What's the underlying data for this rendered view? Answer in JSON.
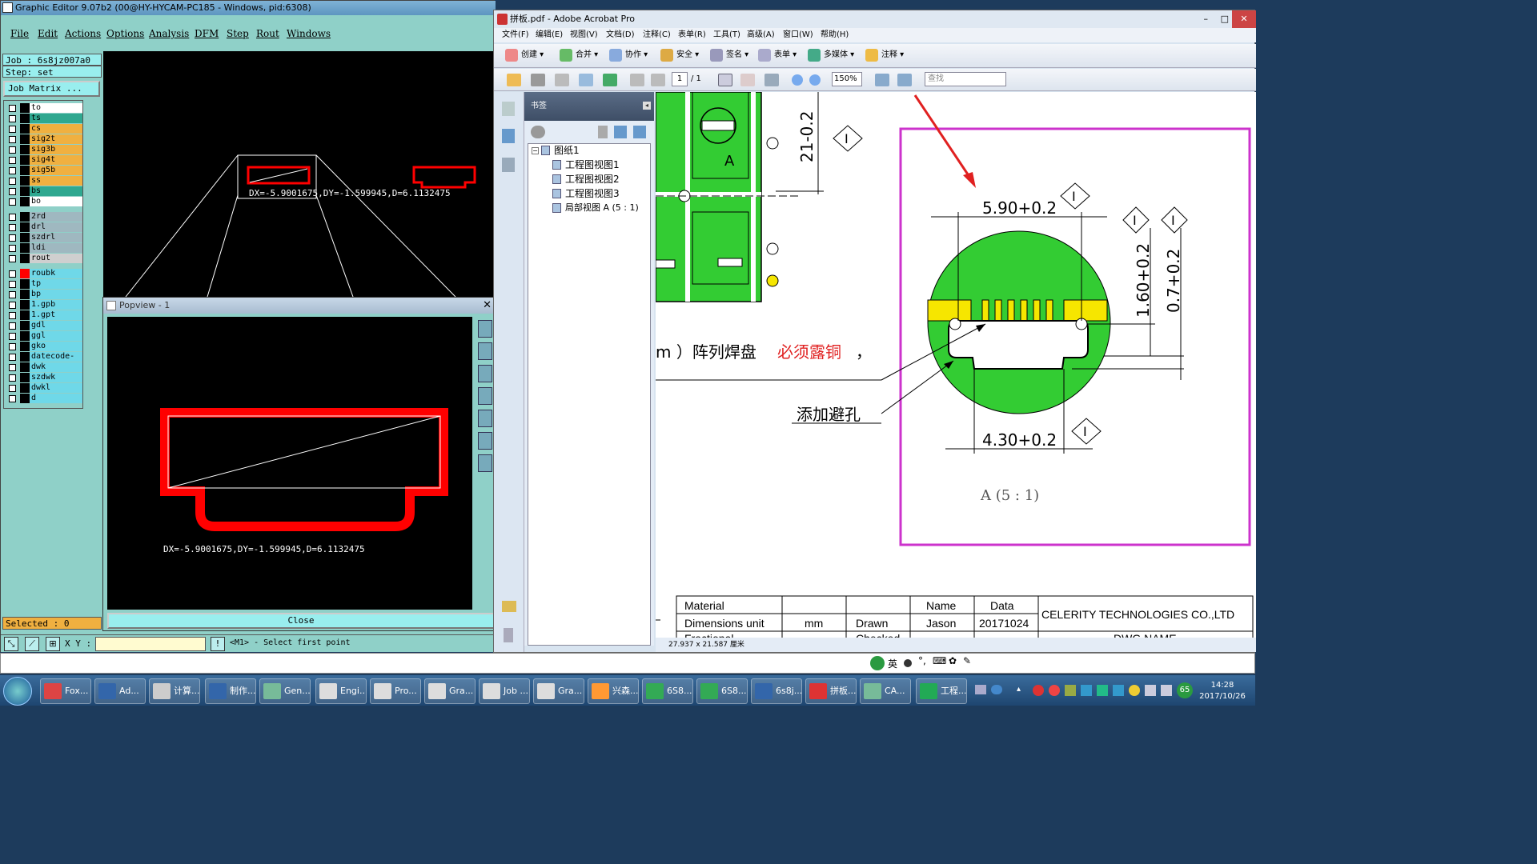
{
  "ge": {
    "title": "Graphic Editor 9.07b2 (00@HY-HYCAM-PC185 - Windows, pid:6308)",
    "menu": [
      "File",
      "Edit",
      "Actions",
      "Options",
      "Analysis",
      "DFM",
      "Step",
      "Rout",
      "Windows"
    ],
    "job": "Job  : 6s8jz007a0",
    "step": "Step: set",
    "job_matrix": "Job Matrix ...",
    "layers": [
      {
        "name": "to",
        "color": "#ffffff"
      },
      {
        "name": "ts",
        "color": "#2fa890"
      },
      {
        "name": "cs",
        "color": "#f0b040"
      },
      {
        "name": "sig2t",
        "color": "#f0b040"
      },
      {
        "name": "sig3b",
        "color": "#f0b040"
      },
      {
        "name": "sig4t",
        "color": "#f0b040"
      },
      {
        "name": "sig5b",
        "color": "#f0b040"
      },
      {
        "name": "ss",
        "color": "#f0b040"
      },
      {
        "name": "bs",
        "color": "#2fa890"
      },
      {
        "name": "bo",
        "color": "#ffffff"
      },
      {
        "name": "2rd",
        "color": "#9fb8c0"
      },
      {
        "name": "drl",
        "color": "#9fb8c0"
      },
      {
        "name": "szdrl",
        "color": "#9fb8c0"
      },
      {
        "name": "ldi",
        "color": "#9fb8c0"
      },
      {
        "name": "rout",
        "color": "#cfcfcf"
      },
      {
        "name": "roubk",
        "color": "#6fd8e8"
      },
      {
        "name": "tp",
        "color": "#6fd8e8"
      },
      {
        "name": "bp",
        "color": "#6fd8e8"
      },
      {
        "name": "1.gpb",
        "color": "#6fd8e8"
      },
      {
        "name": "1.gpt",
        "color": "#6fd8e8"
      },
      {
        "name": "gdl",
        "color": "#6fd8e8"
      },
      {
        "name": "ggl",
        "color": "#6fd8e8"
      },
      {
        "name": "gko",
        "color": "#6fd8e8"
      },
      {
        "name": "datecode-pt",
        "color": "#6fd8e8"
      },
      {
        "name": "dwk",
        "color": "#6fd8e8"
      },
      {
        "name": "szdwk",
        "color": "#6fd8e8"
      },
      {
        "name": "dwkl",
        "color": "#6fd8e8"
      },
      {
        "name": "d",
        "color": "#6fd8e8"
      }
    ],
    "measure": "DX=-5.9001675,DY=-1.599945,D=6.1132475",
    "selected": "Selected : 0",
    "xy_label": "X Y :",
    "prompt": "<M1> - Select first point",
    "popview_title": "Popview - 1",
    "close_label": "Close"
  },
  "acrobat": {
    "title": "拼板.pdf - Adobe Acrobat Pro",
    "menu": [
      "文件(F)",
      "编辑(E)",
      "视图(V)",
      "文档(D)",
      "注释(C)",
      "表单(R)",
      "工具(T)",
      "高级(A)",
      "窗口(W)",
      "帮助(H)"
    ],
    "toolbar": [
      "创建",
      "合并",
      "协作",
      "安全",
      "签名",
      "表单",
      "多媒体",
      "注释"
    ],
    "page_current": "1",
    "page_total": "/ 1",
    "zoom": "150%",
    "find_placeholder": "查找",
    "bookmarks_title": "书签",
    "bookmarks": [
      "图纸1",
      "工程图视图1",
      "工程图视图2",
      "工程图视图3",
      "局部视图 A (5 : 1)"
    ],
    "status_size": "27.937 x 21.587 厘米",
    "drawing": {
      "dim_top": "5.90+0.2",
      "dim_bottom": "4.30+0.2",
      "dim_v1": "1.60+0.2",
      "dim_v2": "0.7+0.2",
      "dim_side": "21-0.2",
      "marker": "I",
      "label_a": "A",
      "note": "m ）阵列焊盘",
      "note_red": "必须露铜",
      "note_tail": "，",
      "avoid_hole": "添加避孔",
      "view_label": "A (5 : 1)"
    },
    "title_block": {
      "material": "Material",
      "name_h": "Name",
      "data_h": "Data",
      "company": "CELERITY TECHNOLOGIES CO.,LTD",
      "dim_unit": "Dimensions unit",
      "mm": "mm",
      "drawn": "Drawn",
      "jason": "Jason",
      "date": "20171024",
      "fractional": "Fractional",
      "checked": "Checked",
      "dwg_name": "DWG NAME"
    }
  },
  "taskbar": {
    "ime": "英",
    "items": [
      "Fox...",
      "Ad...",
      "计算...",
      "制作...",
      "Gen...",
      "Engi...",
      "Pro...",
      "Gra...",
      "Job ...",
      "Gra...",
      "兴森...",
      "6S8...",
      "6S8...",
      "6s8j...",
      "拼板...",
      "CA...",
      "工程..."
    ],
    "time": "14:28",
    "date": "2017/10/26",
    "badge": "65"
  },
  "colors": {
    "pcb_green": "#33cc33",
    "pad_yellow": "#f6e600",
    "magenta": "#cc33cc",
    "rout_red": "#ff0000"
  }
}
